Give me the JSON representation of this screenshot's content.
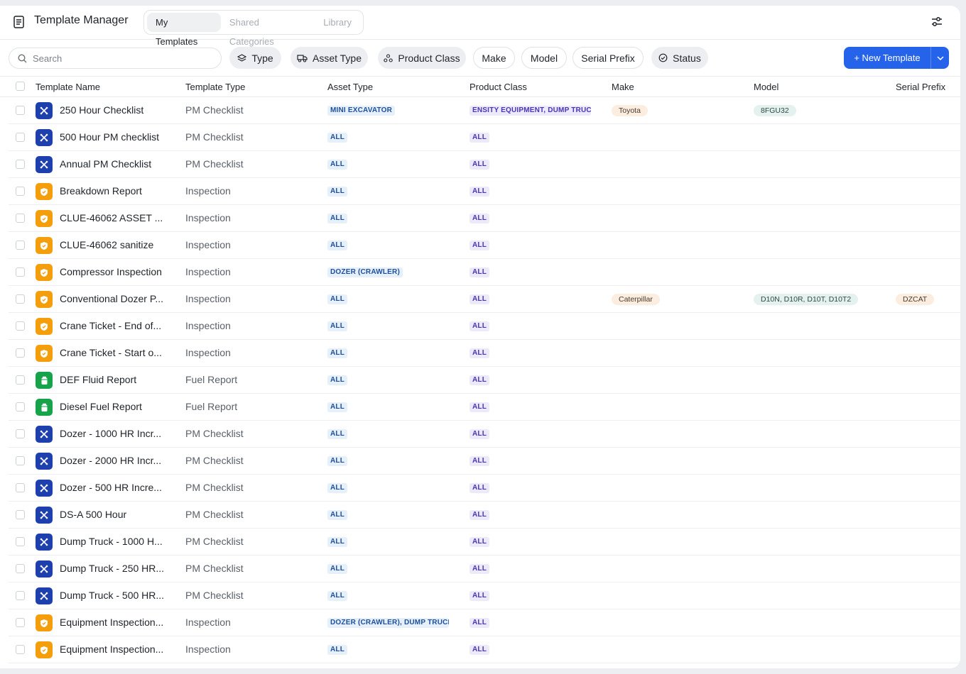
{
  "header": {
    "title": "Template Manager",
    "tabs": [
      {
        "label": "My Templates",
        "active": true
      },
      {
        "label": "Shared Categories",
        "active": false
      },
      {
        "label": "Library",
        "active": false
      }
    ]
  },
  "toolbar": {
    "search_placeholder": "Search",
    "filters": [
      {
        "label": "Type",
        "icon": "layers-icon"
      },
      {
        "label": "Asset Type",
        "icon": "truck-icon"
      },
      {
        "label": "Product Class",
        "icon": "nodes-icon"
      },
      {
        "label": "Make"
      },
      {
        "label": "Model"
      },
      {
        "label": "Serial Prefix"
      },
      {
        "label": "Status",
        "icon": "check-circle-icon"
      }
    ],
    "new_button": "+ New Template"
  },
  "table": {
    "columns": [
      "Template Name",
      "Template Type",
      "Asset Type",
      "Product Class",
      "Make",
      "Model",
      "Serial Prefix"
    ],
    "rows": [
      {
        "name": "250 Hour Checklist",
        "type": "PM Checklist",
        "kind": "pm",
        "asset": "MINI EXCAVATOR",
        "cls": "ENSITY EQUIPMENT, DUMP TRUC",
        "make": "Toyota",
        "model": "8FGU32",
        "serial": ""
      },
      {
        "name": "500 Hour PM checklist",
        "type": "PM Checklist",
        "kind": "pm",
        "asset": "ALL",
        "cls": "ALL",
        "make": "",
        "model": "",
        "serial": ""
      },
      {
        "name": "Annual PM Checklist",
        "type": "PM Checklist",
        "kind": "pm",
        "asset": "ALL",
        "cls": "ALL",
        "make": "",
        "model": "",
        "serial": ""
      },
      {
        "name": "Breakdown Report",
        "type": "Inspection",
        "kind": "insp",
        "asset": "ALL",
        "cls": "ALL",
        "make": "",
        "model": "",
        "serial": ""
      },
      {
        "name": "CLUE-46062 ASSET ...",
        "type": "Inspection",
        "kind": "insp",
        "asset": "ALL",
        "cls": "ALL",
        "make": "",
        "model": "",
        "serial": ""
      },
      {
        "name": "CLUE-46062 sanitize",
        "type": "Inspection",
        "kind": "insp",
        "asset": "ALL",
        "cls": "ALL",
        "make": "",
        "model": "",
        "serial": ""
      },
      {
        "name": "Compressor Inspection",
        "type": "Inspection",
        "kind": "insp",
        "asset": "DOZER (CRAWLER)",
        "cls": "ALL",
        "make": "",
        "model": "",
        "serial": ""
      },
      {
        "name": "Conventional Dozer P...",
        "type": "Inspection",
        "kind": "insp",
        "asset": "ALL",
        "cls": "ALL",
        "make": "Caterpillar",
        "model": "D10N, D10R, D10T, D10T2",
        "serial": "DZCAT"
      },
      {
        "name": "Crane Ticket - End of...",
        "type": "Inspection",
        "kind": "insp",
        "asset": "ALL",
        "cls": "ALL",
        "make": "",
        "model": "",
        "serial": ""
      },
      {
        "name": "Crane Ticket - Start o...",
        "type": "Inspection",
        "kind": "insp",
        "asset": "ALL",
        "cls": "ALL",
        "make": "",
        "model": "",
        "serial": ""
      },
      {
        "name": "DEF Fluid Report",
        "type": "Fuel Report",
        "kind": "fuel",
        "asset": "ALL",
        "cls": "ALL",
        "make": "",
        "model": "",
        "serial": ""
      },
      {
        "name": "Diesel Fuel Report",
        "type": "Fuel Report",
        "kind": "fuel",
        "asset": "ALL",
        "cls": "ALL",
        "make": "",
        "model": "",
        "serial": ""
      },
      {
        "name": "Dozer - 1000 HR Incr...",
        "type": "PM Checklist",
        "kind": "pm",
        "asset": "ALL",
        "cls": "ALL",
        "make": "",
        "model": "",
        "serial": ""
      },
      {
        "name": "Dozer - 2000 HR Incr...",
        "type": "PM Checklist",
        "kind": "pm",
        "asset": "ALL",
        "cls": "ALL",
        "make": "",
        "model": "",
        "serial": ""
      },
      {
        "name": "Dozer - 500 HR Incre...",
        "type": "PM Checklist",
        "kind": "pm",
        "asset": "ALL",
        "cls": "ALL",
        "make": "",
        "model": "",
        "serial": ""
      },
      {
        "name": "DS-A 500 Hour",
        "type": "PM Checklist",
        "kind": "pm",
        "asset": "ALL",
        "cls": "ALL",
        "make": "",
        "model": "",
        "serial": ""
      },
      {
        "name": "Dump Truck - 1000 H...",
        "type": "PM Checklist",
        "kind": "pm",
        "asset": "ALL",
        "cls": "ALL",
        "make": "",
        "model": "",
        "serial": ""
      },
      {
        "name": "Dump Truck - 250 HR...",
        "type": "PM Checklist",
        "kind": "pm",
        "asset": "ALL",
        "cls": "ALL",
        "make": "",
        "model": "",
        "serial": ""
      },
      {
        "name": "Dump Truck - 500 HR...",
        "type": "PM Checklist",
        "kind": "pm",
        "asset": "ALL",
        "cls": "ALL",
        "make": "",
        "model": "",
        "serial": ""
      },
      {
        "name": "Equipment Inspection...",
        "type": "Inspection",
        "kind": "insp",
        "asset": "DOZER (CRAWLER), DUMP TRUCI",
        "cls": "ALL",
        "make": "",
        "model": "",
        "serial": ""
      },
      {
        "name": "Equipment Inspection...",
        "type": "Inspection",
        "kind": "insp",
        "asset": "ALL",
        "cls": "ALL",
        "make": "",
        "model": "",
        "serial": ""
      }
    ]
  },
  "colors": {
    "accent": "#2563eb",
    "pm": "#1e40af",
    "inspection": "#f59e0b",
    "fuel": "#16a34a"
  }
}
